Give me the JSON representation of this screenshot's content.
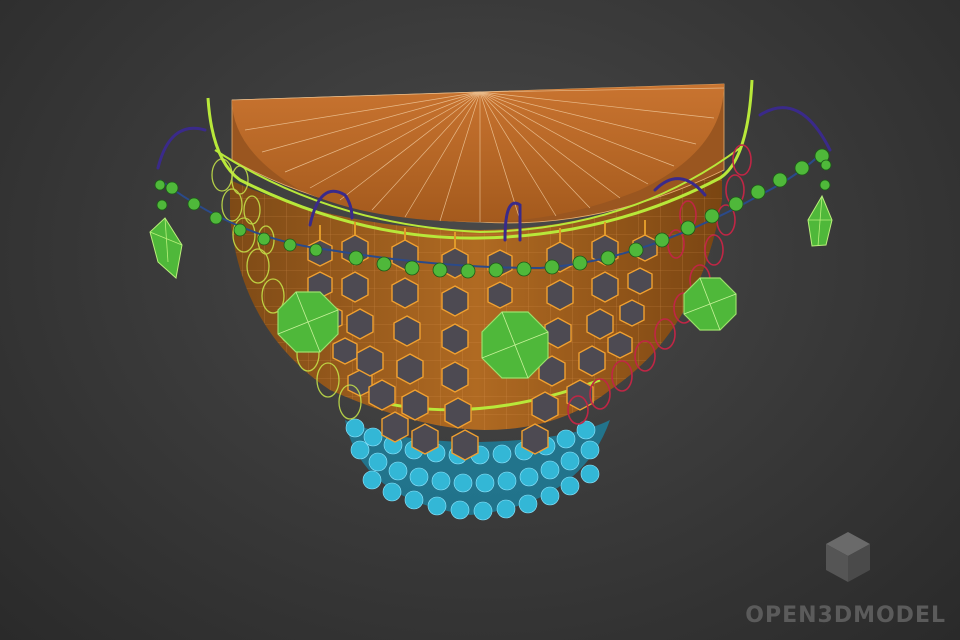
{
  "scene": {
    "subject": "wireframe-chandelier-model",
    "colors": {
      "background": "#3a3a3a",
      "top_plate": "#c8702a",
      "bowl": "#b0661f",
      "yellow_trim": "#b8e83a",
      "green_crystal": "#4fb83a",
      "cyan_bead": "#33b7d6",
      "red_chain": "#c02645",
      "purple_hook": "#3a2a8a",
      "orange_link": "#e09a2a"
    }
  },
  "watermark": {
    "text": "OPEN3DMODEL",
    "logo_icon": "cube-icon"
  }
}
